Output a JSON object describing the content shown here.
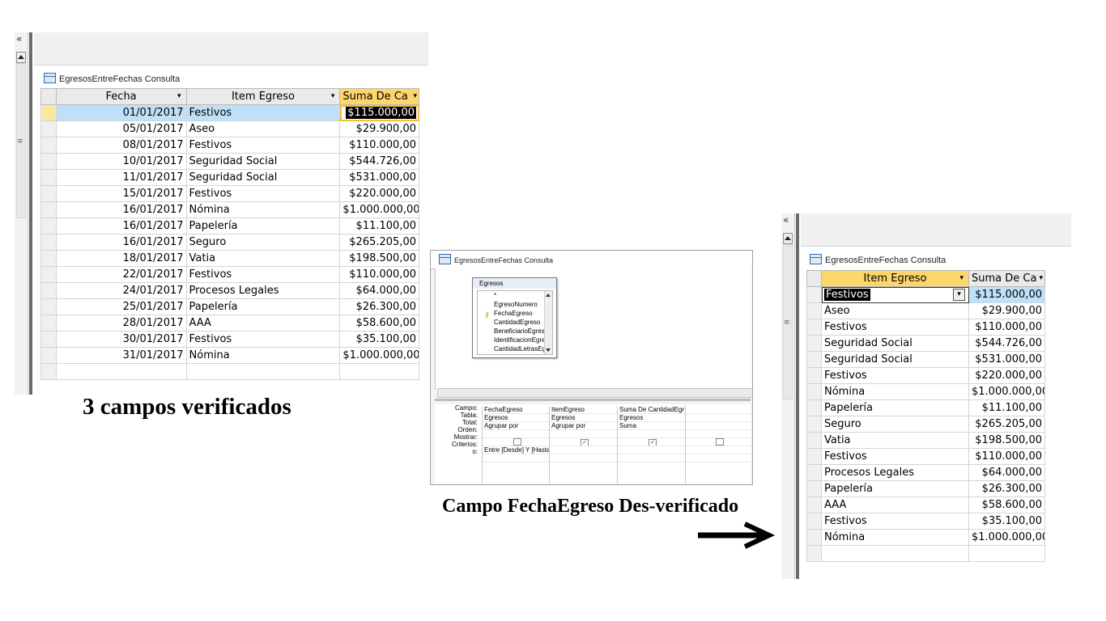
{
  "panel1": {
    "nav_chevron": "«",
    "tab_title": "EgresosEntreFechas Consulta",
    "headers": [
      "Fecha",
      "Item Egreso",
      "Suma De Ca"
    ],
    "header_arrows": [
      "▾",
      "▾",
      "▾"
    ],
    "rows": [
      [
        "01/01/2017",
        "Festivos",
        "$115.000,00"
      ],
      [
        "05/01/2017",
        "Aseo",
        "$29.900,00"
      ],
      [
        "08/01/2017",
        "Festivos",
        "$110.000,00"
      ],
      [
        "10/01/2017",
        "Seguridad Social",
        "$544.726,00"
      ],
      [
        "11/01/2017",
        "Seguridad Social",
        "$531.000,00"
      ],
      [
        "15/01/2017",
        "Festivos",
        "$220.000,00"
      ],
      [
        "16/01/2017",
        "Nómina",
        "$1.000.000,00"
      ],
      [
        "16/01/2017",
        "Papelería",
        "$11.100,00"
      ],
      [
        "16/01/2017",
        "Seguro",
        "$265.205,00"
      ],
      [
        "18/01/2017",
        "Vatia",
        "$198.500,00"
      ],
      [
        "22/01/2017",
        "Festivos",
        "$110.000,00"
      ],
      [
        "24/01/2017",
        "Procesos Legales",
        "$64.000,00"
      ],
      [
        "25/01/2017",
        "Papelería",
        "$26.300,00"
      ],
      [
        "28/01/2017",
        "AAA",
        "$58.600,00"
      ],
      [
        "30/01/2017",
        "Festivos",
        "$35.100,00"
      ],
      [
        "31/01/2017",
        "Nómina",
        "$1.000.000,00"
      ]
    ],
    "caption": "3 campos verificados"
  },
  "panel2": {
    "tab_title": "EgresosEntreFechas Consulta",
    "table_name": "Egresos",
    "fields": [
      "*",
      "EgresoNumero",
      "FechaEgreso",
      "CantidadEgreso",
      "BeneficiarioEgreso",
      "IdentificacionEgreso",
      "CantidadLetrasEgreso"
    ],
    "row_labels": [
      "Campo:",
      "Tabla:",
      "Total:",
      "Orden:",
      "Mostrar:",
      "Criterios:",
      "o:"
    ],
    "columns": [
      {
        "campo": "FechaEgreso",
        "tabla": "Egresos",
        "total": "",
        "mostrar": false,
        "criterios": "Entre [Desde] Y [Hasta"
      },
      {
        "campo": "ItemEgreso",
        "tabla": "Egresos",
        "total": "Agrupar por",
        "mostrar": true,
        "criterios": ""
      },
      {
        "campo": "Suma De CantidadEgr",
        "tabla": "Egresos",
        "total": "Suma",
        "mostrar": true,
        "criterios": ""
      },
      {
        "campo": "",
        "tabla": "",
        "total": "",
        "mostrar": false,
        "criterios": ""
      }
    ],
    "col1_total": "Agrupar por",
    "check_mark": "✓",
    "caption": "Campo FechaEgreso Des-verificado"
  },
  "panel3": {
    "nav_chevron": "«",
    "tab_title": "EgresosEntreFechas Consulta",
    "headers": [
      "Item Egreso",
      "Suma De Ca"
    ],
    "header_arrows": [
      "▾",
      "▾"
    ],
    "combo_arrow": "▾",
    "rows": [
      [
        "Festivos",
        "$115.000,00"
      ],
      [
        "Aseo",
        "$29.900,00"
      ],
      [
        "Festivos",
        "$110.000,00"
      ],
      [
        "Seguridad Social",
        "$544.726,00"
      ],
      [
        "Seguridad Social",
        "$531.000,00"
      ],
      [
        "Festivos",
        "$220.000,00"
      ],
      [
        "Nómina",
        "$1.000.000,00"
      ],
      [
        "Papelería",
        "$11.100,00"
      ],
      [
        "Seguro",
        "$265.205,00"
      ],
      [
        "Vatia",
        "$198.500,00"
      ],
      [
        "Festivos",
        "$110.000,00"
      ],
      [
        "Procesos Legales",
        "$64.000,00"
      ],
      [
        "Papelería",
        "$26.300,00"
      ],
      [
        "AAA",
        "$58.600,00"
      ],
      [
        "Festivos",
        "$35.100,00"
      ],
      [
        "Nómina",
        "$1.000.000,00"
      ]
    ]
  },
  "colors": {
    "header_highlight": "#fdd66b",
    "row_highlight": "#bfe0f8"
  }
}
